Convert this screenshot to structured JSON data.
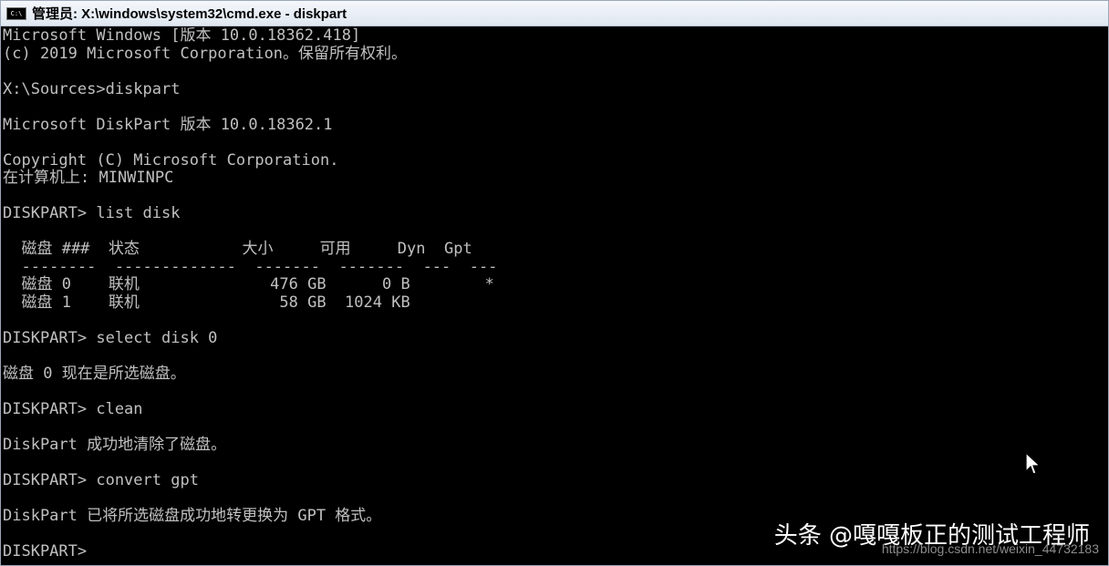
{
  "window": {
    "icon_label": "C:\\",
    "title": "管理员: X:\\windows\\system32\\cmd.exe - diskpart"
  },
  "console": {
    "lines": [
      "Microsoft Windows [版本 10.0.18362.418]",
      "(c) 2019 Microsoft Corporation。保留所有权利。",
      "",
      "X:\\Sources>diskpart",
      "",
      "Microsoft DiskPart 版本 10.0.18362.1",
      "",
      "Copyright (C) Microsoft Corporation.",
      "在计算机上: MINWINPC",
      "",
      "DISKPART> list disk",
      "",
      "  磁盘 ###  状态           大小     可用     Dyn  Gpt",
      "  --------  -------------  -------  -------  ---  ---",
      "  磁盘 0    联机              476 GB      0 B        *",
      "  磁盘 1    联机               58 GB  1024 KB",
      "",
      "DISKPART> select disk 0",
      "",
      "磁盘 0 现在是所选磁盘。",
      "",
      "DISKPART> clean",
      "",
      "DiskPart 成功地清除了磁盘。",
      "",
      "DISKPART> convert gpt",
      "",
      "DiskPart 已将所选磁盘成功地转更换为 GPT 格式。",
      "",
      "DISKPART>"
    ]
  },
  "overlay": {
    "watermark": "头条 @嘎嘎板正的测试工程师",
    "url": "https://blog.csdn.net/weixin_44732183"
  },
  "colors": {
    "console_bg": "#000000",
    "console_text": "#c0c0c0",
    "titlebar_bg": "#e4ebf3"
  },
  "icons": {
    "window_icon": "cmd-icon",
    "cursor": "mouse-pointer-icon"
  }
}
